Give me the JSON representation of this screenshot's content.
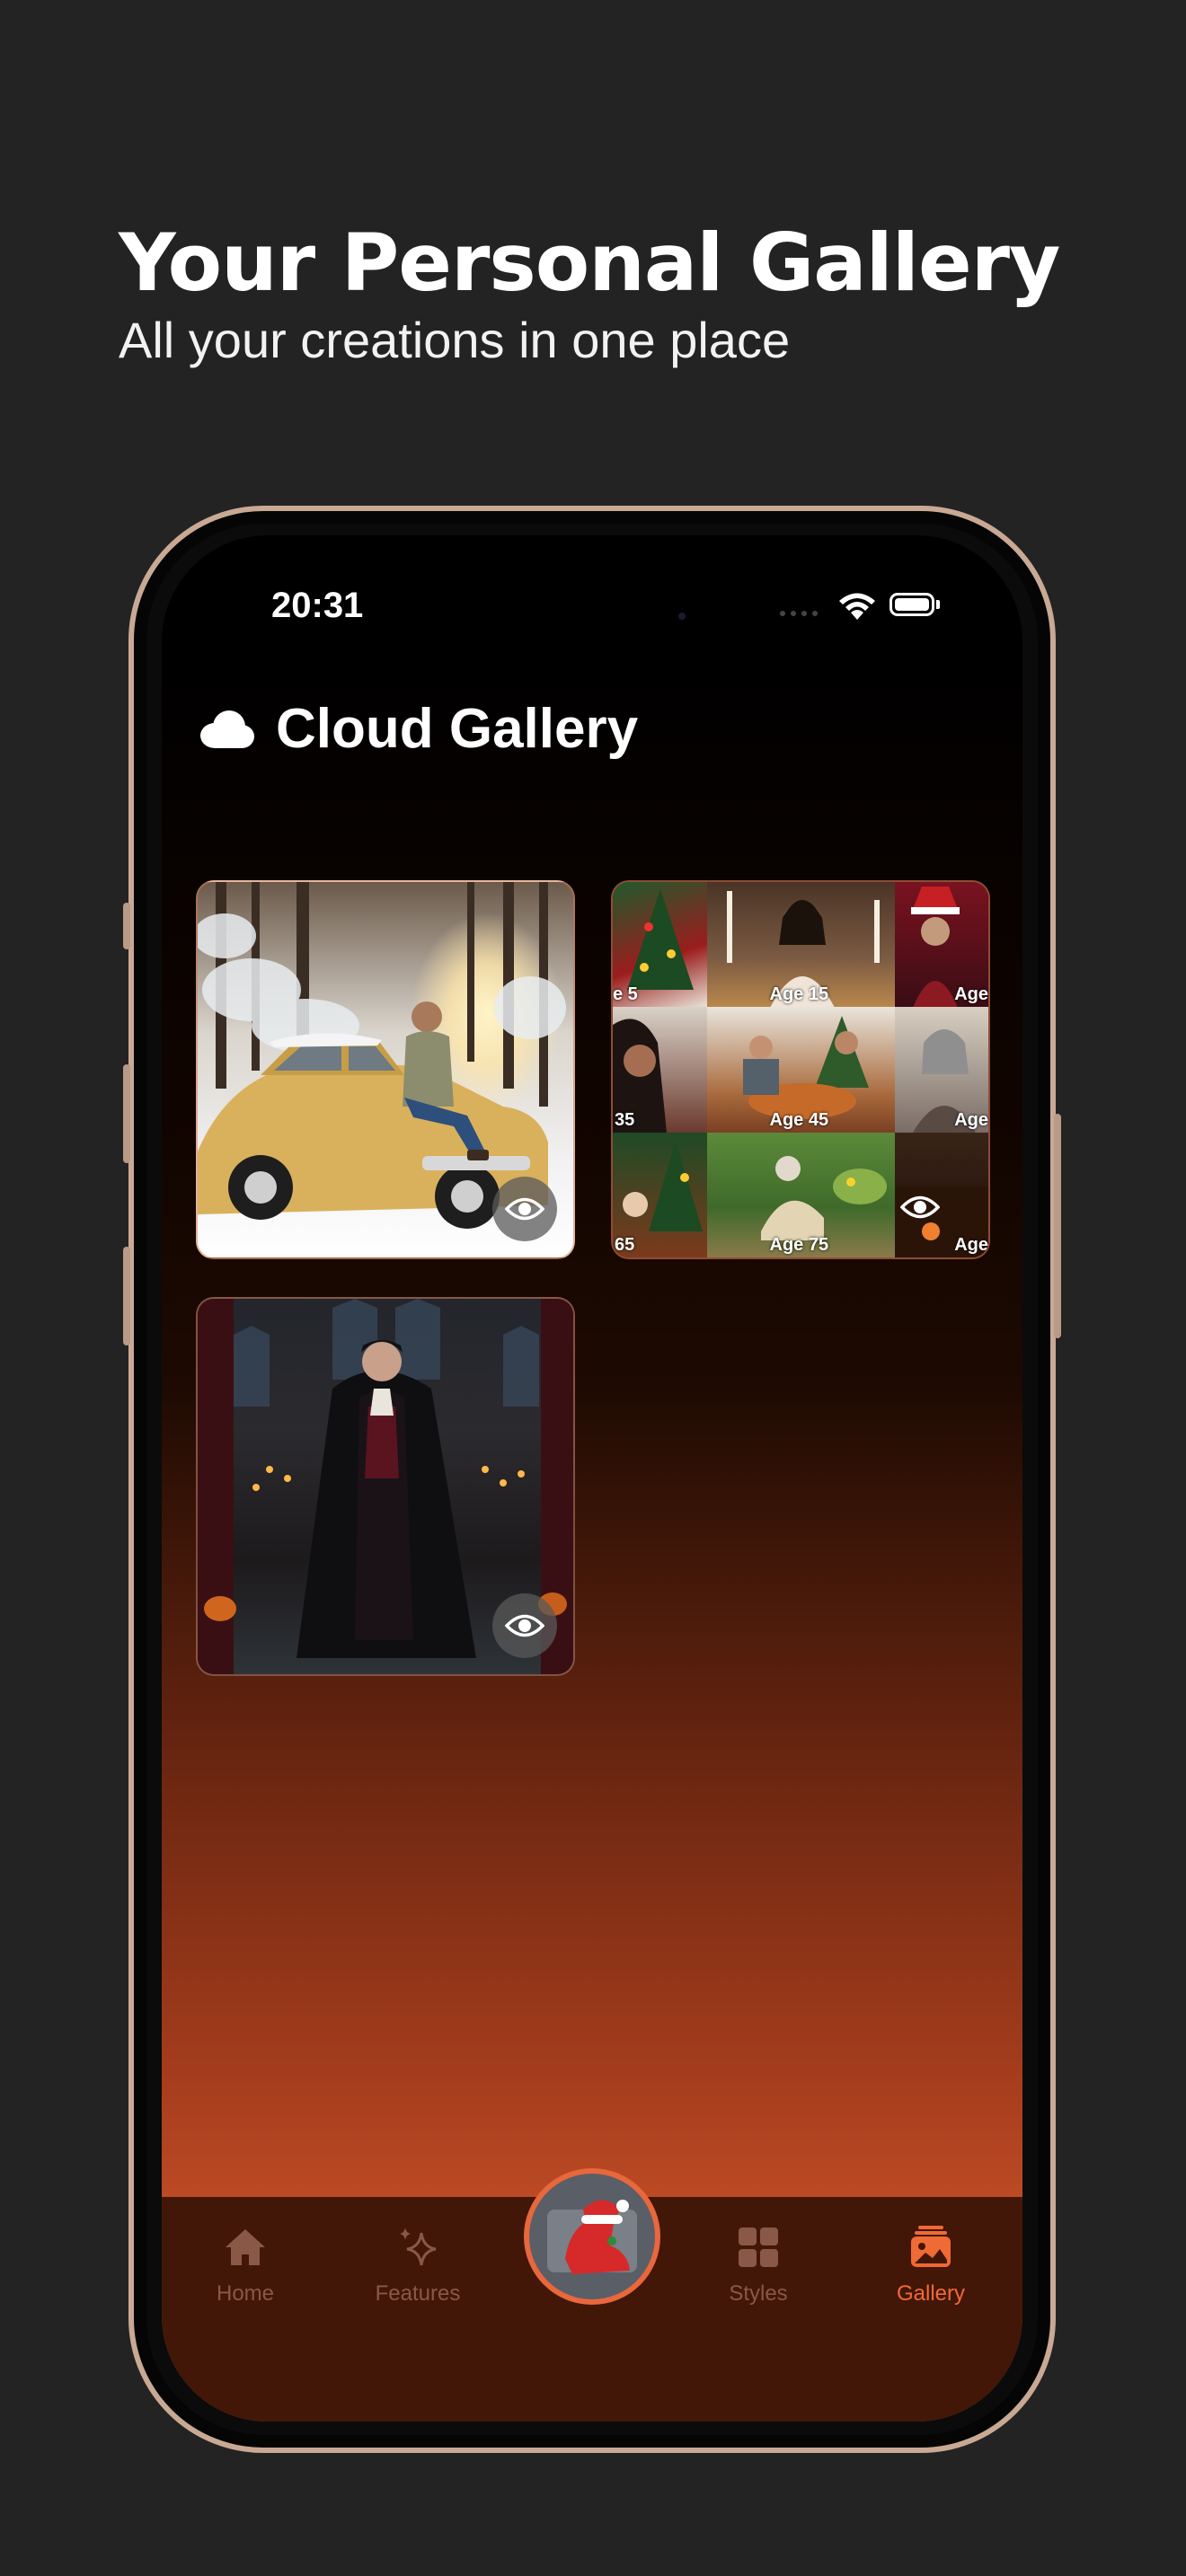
{
  "headline": {
    "title": "Your Personal Gallery",
    "subtitle": "All your creations in one place"
  },
  "status_bar": {
    "time": "20:31",
    "icons": [
      "wifi-icon",
      "battery-icon"
    ]
  },
  "gallery": {
    "title": "Cloud Gallery",
    "icon": "cloud-icon",
    "items": [
      {
        "subject": "Man sitting on a vintage yellow car in a snowy forest",
        "action": "eye-icon"
      },
      {
        "subject": "Holiday age-progression collage",
        "ages": [
          "e 5",
          "Age 15",
          "Age",
          "35",
          "Age 45",
          "Age",
          "65",
          "Age 75",
          "Age"
        ],
        "action": "eye-icon"
      },
      {
        "subject": "Vampire in a gothic candlelit hall",
        "action": "eye-icon"
      }
    ]
  },
  "tabbar": {
    "tabs": [
      {
        "label": "Home",
        "icon": "home-icon",
        "active": false
      },
      {
        "label": "Features",
        "icon": "sparkles-icon",
        "active": false
      },
      {
        "label": "",
        "icon": "christmas-shoe-icon",
        "active": false
      },
      {
        "label": "Styles",
        "icon": "grid-icon",
        "active": false
      },
      {
        "label": "Gallery",
        "icon": "gallery-icon",
        "active": true
      }
    ],
    "active_color": "#f06a35",
    "inactive_color": "#8a5846"
  },
  "colors": {
    "page_background": "#232323",
    "frame": "#c9a994",
    "gradient_bottom": "#c9522a"
  }
}
